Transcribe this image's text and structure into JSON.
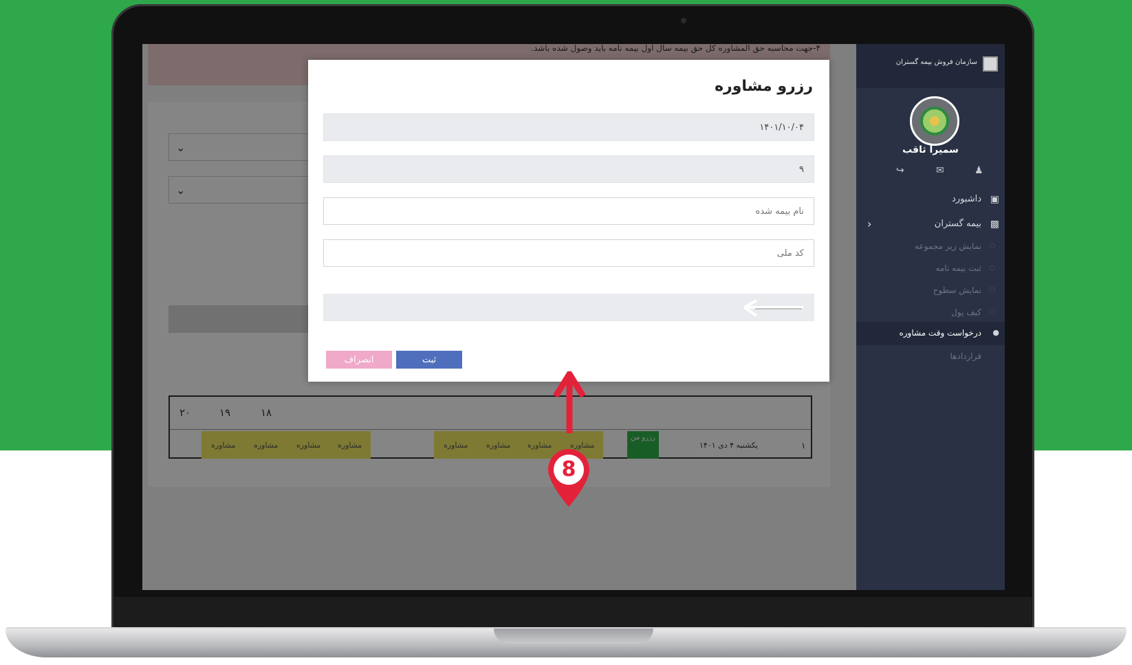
{
  "background": {
    "top_color": "#2ea84a",
    "bottom_color": "#ffffff"
  },
  "alert": {
    "text": "۴-جهت محاسبه حق المشاوره کل حق بیمه سال اول بیمه نامه باید وصول شده باشد."
  },
  "table": {
    "header_days": [
      "۲۰",
      "۱۹",
      "۱۸"
    ],
    "cell_word": "مشاوره",
    "row_number": "۱",
    "row_date": "یکشنبه ۴ دی ۱۴۰۱",
    "green_cell_text": "رزرو من"
  },
  "sidebar": {
    "org_name": "سازمان فروش بیمه گستران",
    "user_name": "سمیرا ثاقب",
    "nav": [
      {
        "label": "داشبورد",
        "icon": "monitor-icon"
      },
      {
        "label": "بیمه گستران",
        "icon": "sitemap-icon"
      }
    ],
    "sub_items": [
      "نمایش زیر مجموعه",
      "ثبت بیمه نامه",
      "نمایش سطوح",
      "کیف پول"
    ],
    "active_item": "درخواست وقت مشاوره",
    "last_item": "قراردادها"
  },
  "modal": {
    "title": "رزرو مشاوره",
    "date_value": "۱۴۰۱/۱۰/۰۴",
    "hour_value": "۹",
    "insured_name_placeholder": "نام بیمه شده",
    "national_code_placeholder": "کد ملی",
    "submit_label": "ثبت",
    "cancel_label": "انصراف"
  },
  "annotation": {
    "step_number": "8",
    "color": "#e3223a"
  }
}
